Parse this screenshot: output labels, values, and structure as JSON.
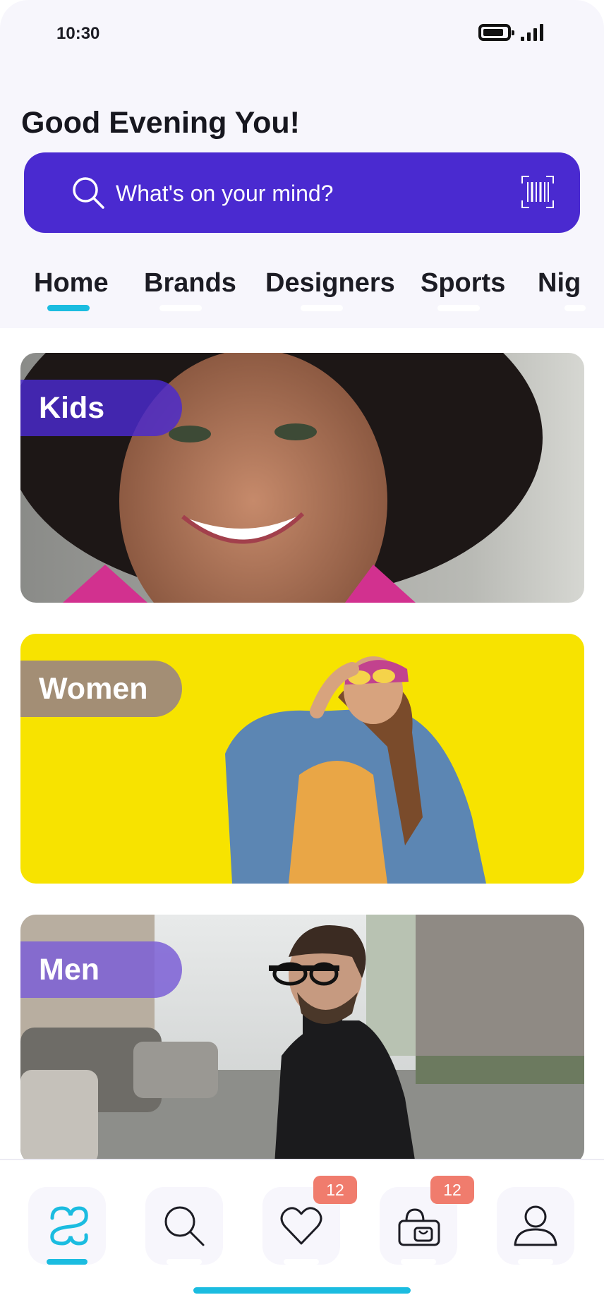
{
  "status_bar": {
    "time": "10:30"
  },
  "greeting": "Good Evening You!",
  "search": {
    "placeholder": "What's on your mind?"
  },
  "tabs": [
    {
      "label": "Home",
      "active": true
    },
    {
      "label": "Brands",
      "active": false
    },
    {
      "label": "Designers",
      "active": false
    },
    {
      "label": "Sports",
      "active": false
    },
    {
      "label": "Nig",
      "active": false
    }
  ],
  "categories": [
    {
      "label": "Kids"
    },
    {
      "label": "Women"
    },
    {
      "label": "Men"
    }
  ],
  "bottom_nav": [
    {
      "icon": "brand-logo-icon",
      "active": true
    },
    {
      "icon": "search-icon",
      "active": false
    },
    {
      "icon": "heart-icon",
      "badge": "12",
      "active": false
    },
    {
      "icon": "shopping-bag-icon",
      "badge": "12",
      "active": false
    },
    {
      "icon": "profile-icon",
      "active": false
    }
  ],
  "colors": {
    "accent": "#4a2ad0",
    "highlight": "#1bbce0",
    "badge": "#f07c6d",
    "kids_label": "#4a2ad0",
    "women_label": "#9d8a74",
    "men_label": "#7b5fd6"
  }
}
